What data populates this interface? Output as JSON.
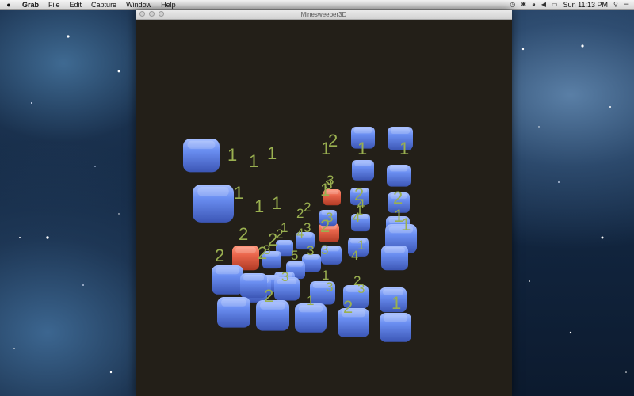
{
  "menubar": {
    "apple_icon": "apple-icon",
    "items": [
      "Grab",
      "File",
      "Edit",
      "Capture",
      "Window",
      "Help"
    ],
    "status_icons": [
      "time-machine-icon",
      "bluetooth-icon",
      "wifi-icon",
      "volume-icon",
      "battery-icon"
    ],
    "clock": "Sun 11:13 PM",
    "search_icon": "spotlight-search-icon",
    "list_icon": "notification-center-icon"
  },
  "window": {
    "title": "Minesweeper3D",
    "mine_color": "#e8644a",
    "cube_color": "#6b8ff2",
    "number_color": "#9ab050"
  }
}
